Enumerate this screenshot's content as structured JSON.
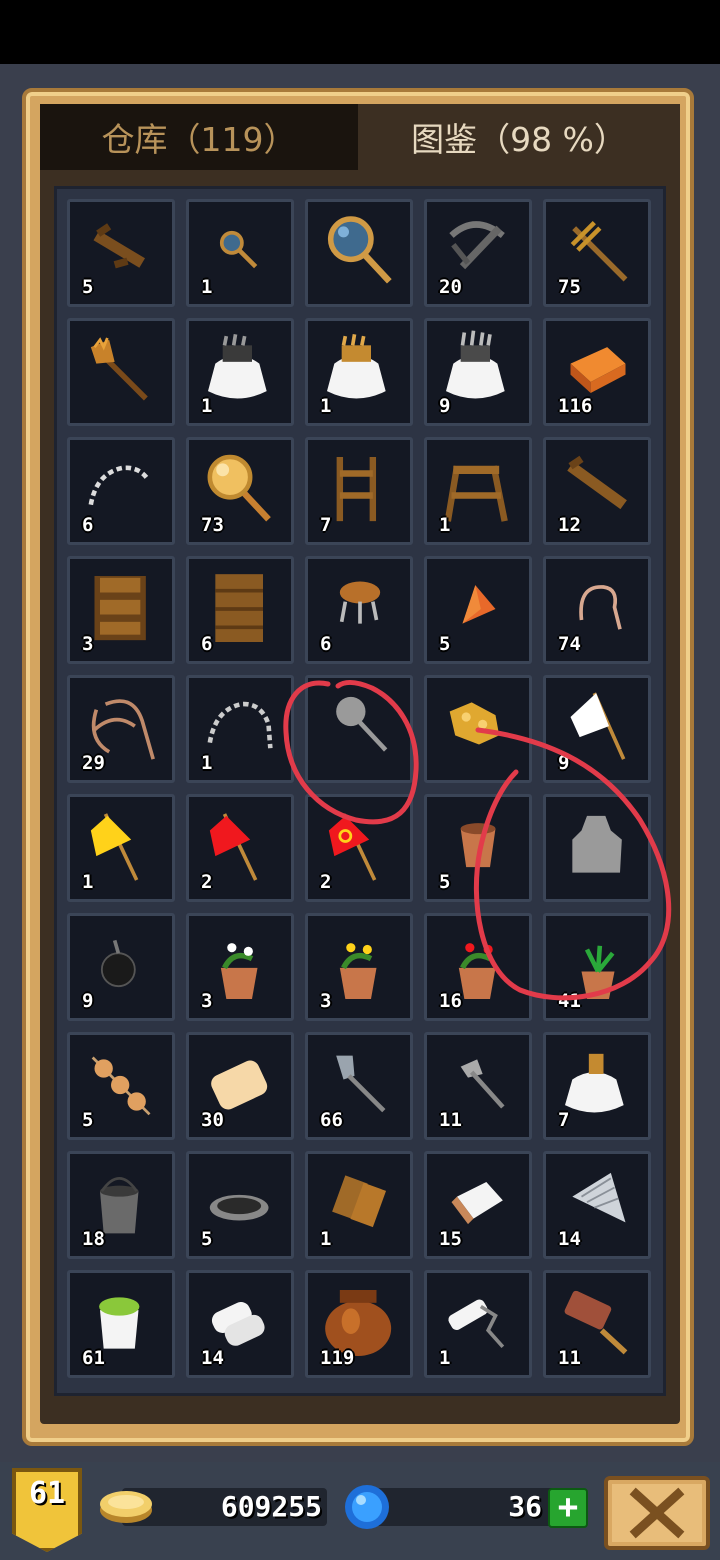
{
  "tabs": {
    "warehouse": "仓库（119）",
    "catalog": "图鉴（98 %）"
  },
  "inventory": [
    {
      "icon": "wooden-beam-icon",
      "count": "5"
    },
    {
      "icon": "small-magnifier-icon",
      "count": "1"
    },
    {
      "icon": "magnifying-glass-icon",
      "count": ""
    },
    {
      "icon": "crossbow-icon",
      "count": "20"
    },
    {
      "icon": "wooden-rake-icon",
      "count": "75"
    },
    {
      "icon": "torch-icon",
      "count": ""
    },
    {
      "icon": "fur-pelt-gray-icon",
      "count": "1"
    },
    {
      "icon": "fur-pelt-gold-icon",
      "count": "1"
    },
    {
      "icon": "fur-pelt-silver-icon",
      "count": "9"
    },
    {
      "icon": "clay-brick-icon",
      "count": "116"
    },
    {
      "icon": "chain-icon",
      "count": "6"
    },
    {
      "icon": "golden-mirror-icon",
      "count": "73"
    },
    {
      "icon": "short-ladder-icon",
      "count": "7"
    },
    {
      "icon": "wooden-trestle-icon",
      "count": "1"
    },
    {
      "icon": "wooden-plank-icon",
      "count": "12"
    },
    {
      "icon": "tall-ladder-icon",
      "count": "3"
    },
    {
      "icon": "wooden-wall-icon",
      "count": "6"
    },
    {
      "icon": "wooden-stool-icon",
      "count": "6"
    },
    {
      "icon": "orange-shard-icon",
      "count": "5"
    },
    {
      "icon": "rope-hook-icon",
      "count": "74"
    },
    {
      "icon": "rope-coil-icon",
      "count": "29"
    },
    {
      "icon": "iron-chain-icon",
      "count": "1"
    },
    {
      "icon": "gray-mirror-silhouette-icon",
      "count": ""
    },
    {
      "icon": "gold-ore-icon",
      "count": ""
    },
    {
      "icon": "white-flag-icon",
      "count": "9"
    },
    {
      "icon": "yellow-flag-icon",
      "count": "1"
    },
    {
      "icon": "red-flag-icon",
      "count": "2"
    },
    {
      "icon": "hammer-sickle-flag-icon",
      "count": "2"
    },
    {
      "icon": "empty-flowerpot-icon",
      "count": "5"
    },
    {
      "icon": "gray-pelt-silhouette-icon",
      "count": ""
    },
    {
      "icon": "black-bomb-icon",
      "count": "9"
    },
    {
      "icon": "white-flower-pot-icon",
      "count": "3"
    },
    {
      "icon": "yellow-flower-pot-icon",
      "count": "3"
    },
    {
      "icon": "red-flower-pot-icon",
      "count": "16"
    },
    {
      "icon": "green-plant-pot-icon",
      "count": "41"
    },
    {
      "icon": "grilled-skewer-icon",
      "count": "5"
    },
    {
      "icon": "soap-bar-icon",
      "count": "30"
    },
    {
      "icon": "shovel-icon",
      "count": "66"
    },
    {
      "icon": "pickaxe-icon",
      "count": "11"
    },
    {
      "icon": "bone-pelt-icon",
      "count": "7"
    },
    {
      "icon": "metal-bucket-icon",
      "count": "18"
    },
    {
      "icon": "cooking-pan-icon",
      "count": "5"
    },
    {
      "icon": "wooden-logs-icon",
      "count": "1"
    },
    {
      "icon": "cloth-bundle-icon",
      "count": "15"
    },
    {
      "icon": "steel-fan-icon",
      "count": "14"
    },
    {
      "icon": "moss-bucket-icon",
      "count": "61"
    },
    {
      "icon": "paper-rolls-icon",
      "count": "14"
    },
    {
      "icon": "clay-jar-icon",
      "count": "119"
    },
    {
      "icon": "paint-roller-icon",
      "count": "1"
    },
    {
      "icon": "brush-icon",
      "count": "11"
    }
  ],
  "resources": {
    "level": "61",
    "coins": "609255",
    "gems": "36",
    "add_label": "+"
  },
  "colors": {
    "frame_gold": "#d4a560",
    "slot_bg": "#141823",
    "slot_border": "#3b4557",
    "annotation_red": "#e23b4a"
  }
}
